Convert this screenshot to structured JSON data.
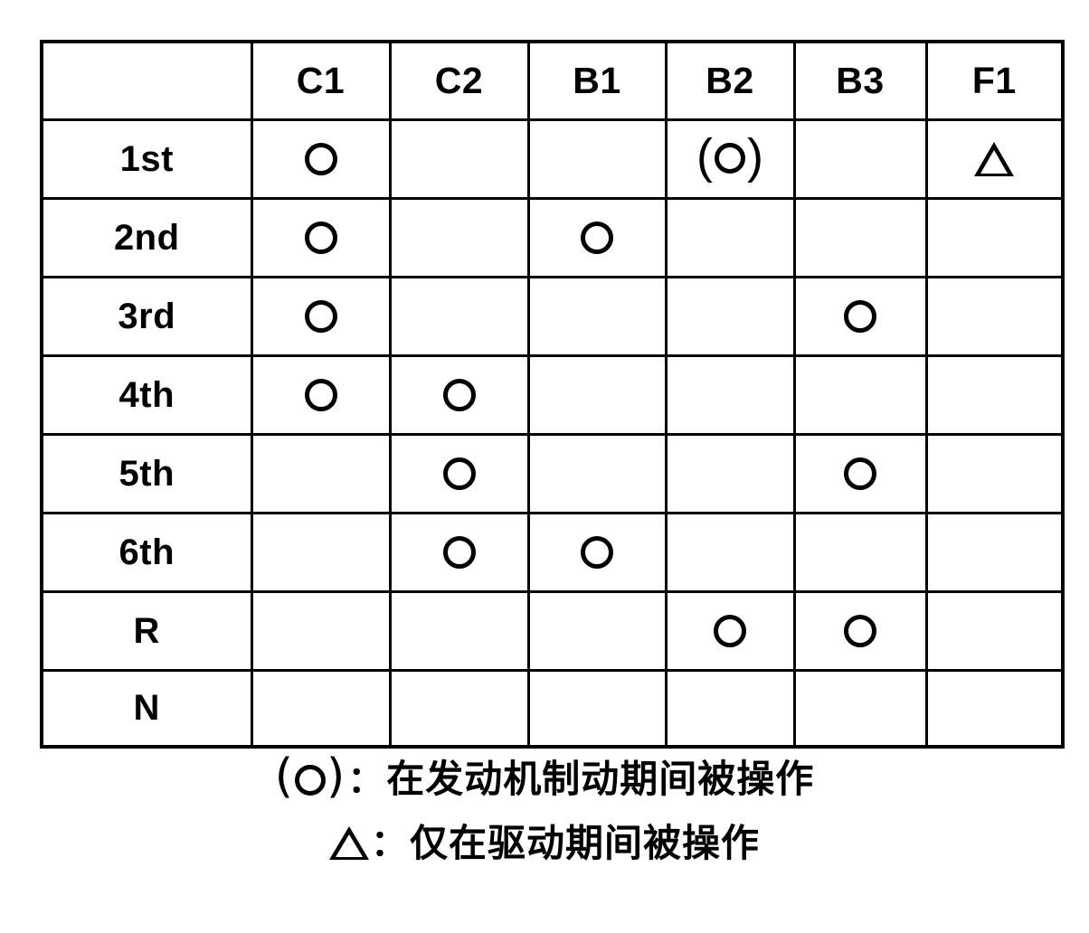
{
  "figure": {
    "type": "engagement-table",
    "columns": [
      "",
      "C1",
      "C2",
      "B1",
      "B2",
      "B3",
      "F1"
    ],
    "row_labels": [
      "1st",
      "2nd",
      "3rd",
      "4th",
      "5th",
      "6th",
      "R",
      "N"
    ],
    "marks": {
      "circle": "○",
      "paren_circle": "(○)",
      "triangle": "△",
      "empty": ""
    },
    "rows": [
      {
        "label": "1st",
        "cells": [
          "circle",
          "empty",
          "empty",
          "paren_circle",
          "empty",
          "triangle"
        ]
      },
      {
        "label": "2nd",
        "cells": [
          "circle",
          "empty",
          "circle",
          "empty",
          "empty",
          "empty"
        ]
      },
      {
        "label": "3rd",
        "cells": [
          "circle",
          "empty",
          "empty",
          "empty",
          "circle",
          "empty"
        ]
      },
      {
        "label": "4th",
        "cells": [
          "circle",
          "circle",
          "empty",
          "empty",
          "empty",
          "empty"
        ]
      },
      {
        "label": "5th",
        "cells": [
          "empty",
          "circle",
          "empty",
          "empty",
          "circle",
          "empty"
        ]
      },
      {
        "label": "6th",
        "cells": [
          "empty",
          "circle",
          "circle",
          "empty",
          "empty",
          "empty"
        ]
      },
      {
        "label": "R",
        "cells": [
          "empty",
          "empty",
          "empty",
          "circle",
          "circle",
          "empty"
        ]
      },
      {
        "label": "N",
        "cells": [
          "empty",
          "empty",
          "empty",
          "empty",
          "empty",
          "empty"
        ]
      }
    ]
  },
  "header": {
    "blank": "",
    "c1": "C1",
    "c2": "C2",
    "b1": "B1",
    "b2": "B2",
    "b3": "B3",
    "f1": "F1"
  },
  "row_labels": {
    "r1": "1st",
    "r2": "2nd",
    "r3": "3rd",
    "r4": "4th",
    "r5": "5th",
    "r6": "6th",
    "r7": "R",
    "r8": "N"
  },
  "legend": {
    "line1": {
      "symbol": "(○)",
      "open_paren": "（",
      "close_paren": "）",
      "colon": "：",
      "text": "在发动机制动期间被操作"
    },
    "line2": {
      "symbol": "△",
      "colon": "：",
      "text": "仅在驱动期间被操作"
    }
  },
  "colors": {
    "ink": "#000000",
    "paper": "#ffffff"
  }
}
